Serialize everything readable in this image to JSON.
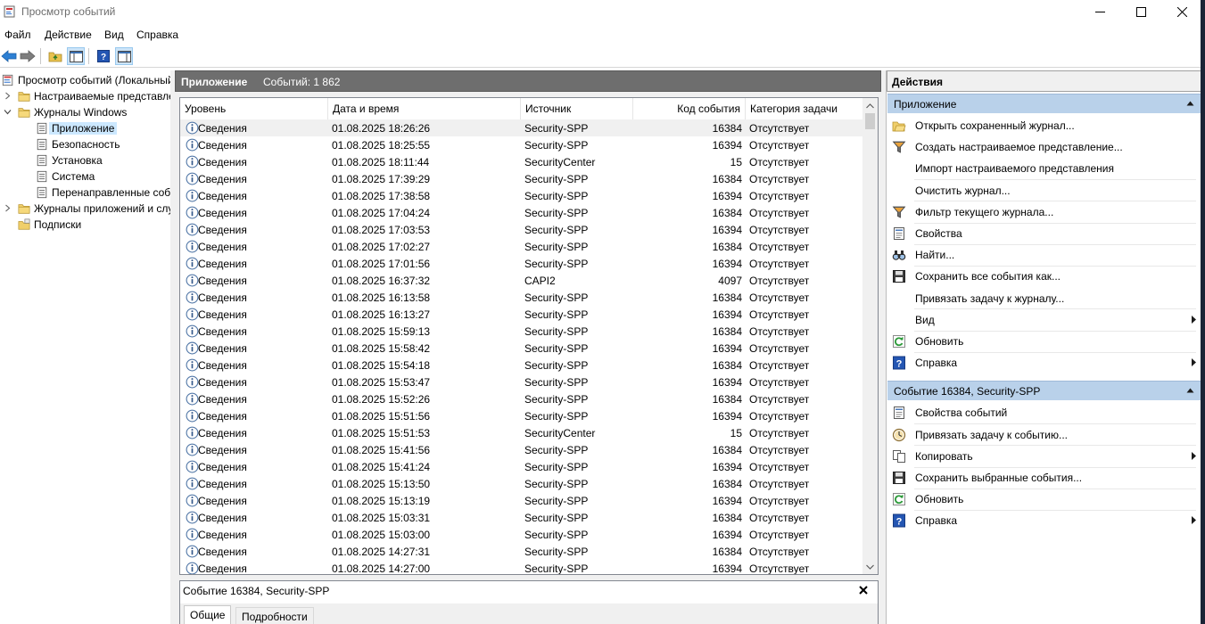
{
  "window": {
    "title": "Просмотр событий"
  },
  "menu": [
    "Файл",
    "Действие",
    "Вид",
    "Справка"
  ],
  "tree": [
    {
      "label": "Просмотр событий (Локальный)",
      "icon": "event-viewer-icon",
      "level": 0,
      "expander": "none"
    },
    {
      "label": "Настраиваемые представления",
      "icon": "folder-icon",
      "level": 1,
      "expander": "collapsed"
    },
    {
      "label": "Журналы Windows",
      "icon": "folder-icon",
      "level": 1,
      "expander": "expanded"
    },
    {
      "label": "Приложение",
      "icon": "log-icon",
      "level": 2,
      "expander": "none",
      "selected": true
    },
    {
      "label": "Безопасность",
      "icon": "log-icon",
      "level": 2,
      "expander": "none"
    },
    {
      "label": "Установка",
      "icon": "log-icon",
      "level": 2,
      "expander": "none"
    },
    {
      "label": "Система",
      "icon": "log-icon",
      "level": 2,
      "expander": "none"
    },
    {
      "label": "Перенаправленные события",
      "icon": "log-icon",
      "level": 2,
      "expander": "none"
    },
    {
      "label": "Журналы приложений и служб",
      "icon": "folder-icon",
      "level": 1,
      "expander": "collapsed"
    },
    {
      "label": "Подписки",
      "icon": "subscriptions-icon",
      "level": 1,
      "expander": "none"
    }
  ],
  "center": {
    "title": "Приложение",
    "count": "Событий: 1 862",
    "columns": [
      "Уровень",
      "Дата и время",
      "Источник",
      "Код события",
      "Категория задачи"
    ],
    "rows": [
      [
        "Сведения",
        "01.08.2025 18:26:26",
        "Security-SPP",
        "16384",
        "Отсутствует"
      ],
      [
        "Сведения",
        "01.08.2025 18:25:55",
        "Security-SPP",
        "16394",
        "Отсутствует"
      ],
      [
        "Сведения",
        "01.08.2025 18:11:44",
        "SecurityCenter",
        "15",
        "Отсутствует"
      ],
      [
        "Сведения",
        "01.08.2025 17:39:29",
        "Security-SPP",
        "16384",
        "Отсутствует"
      ],
      [
        "Сведения",
        "01.08.2025 17:38:58",
        "Security-SPP",
        "16394",
        "Отсутствует"
      ],
      [
        "Сведения",
        "01.08.2025 17:04:24",
        "Security-SPP",
        "16384",
        "Отсутствует"
      ],
      [
        "Сведения",
        "01.08.2025 17:03:53",
        "Security-SPP",
        "16394",
        "Отсутствует"
      ],
      [
        "Сведения",
        "01.08.2025 17:02:27",
        "Security-SPP",
        "16384",
        "Отсутствует"
      ],
      [
        "Сведения",
        "01.08.2025 17:01:56",
        "Security-SPP",
        "16394",
        "Отсутствует"
      ],
      [
        "Сведения",
        "01.08.2025 16:37:32",
        "CAPI2",
        "4097",
        "Отсутствует"
      ],
      [
        "Сведения",
        "01.08.2025 16:13:58",
        "Security-SPP",
        "16384",
        "Отсутствует"
      ],
      [
        "Сведения",
        "01.08.2025 16:13:27",
        "Security-SPP",
        "16394",
        "Отсутствует"
      ],
      [
        "Сведения",
        "01.08.2025 15:59:13",
        "Security-SPP",
        "16384",
        "Отсутствует"
      ],
      [
        "Сведения",
        "01.08.2025 15:58:42",
        "Security-SPP",
        "16394",
        "Отсутствует"
      ],
      [
        "Сведения",
        "01.08.2025 15:54:18",
        "Security-SPP",
        "16384",
        "Отсутствует"
      ],
      [
        "Сведения",
        "01.08.2025 15:53:47",
        "Security-SPP",
        "16394",
        "Отсутствует"
      ],
      [
        "Сведения",
        "01.08.2025 15:52:26",
        "Security-SPP",
        "16384",
        "Отсутствует"
      ],
      [
        "Сведения",
        "01.08.2025 15:51:56",
        "Security-SPP",
        "16394",
        "Отсутствует"
      ],
      [
        "Сведения",
        "01.08.2025 15:51:53",
        "SecurityCenter",
        "15",
        "Отсутствует"
      ],
      [
        "Сведения",
        "01.08.2025 15:41:56",
        "Security-SPP",
        "16384",
        "Отсутствует"
      ],
      [
        "Сведения",
        "01.08.2025 15:41:24",
        "Security-SPP",
        "16394",
        "Отсутствует"
      ],
      [
        "Сведения",
        "01.08.2025 15:13:50",
        "Security-SPP",
        "16384",
        "Отсутствует"
      ],
      [
        "Сведения",
        "01.08.2025 15:13:19",
        "Security-SPP",
        "16394",
        "Отсутствует"
      ],
      [
        "Сведения",
        "01.08.2025 15:03:31",
        "Security-SPP",
        "16384",
        "Отсутствует"
      ],
      [
        "Сведения",
        "01.08.2025 15:03:00",
        "Security-SPP",
        "16394",
        "Отсутствует"
      ],
      [
        "Сведения",
        "01.08.2025 14:27:31",
        "Security-SPP",
        "16384",
        "Отсутствует"
      ],
      [
        "Сведения",
        "01.08.2025 14:27:00",
        "Security-SPP",
        "16394",
        "Отсутствует"
      ]
    ],
    "row_icon": "info-icon"
  },
  "detail": {
    "title": "Событие 16384, Security-SPP",
    "tabs": [
      "Общие",
      "Подробности"
    ]
  },
  "actions": {
    "title": "Действия",
    "sections": [
      {
        "label": "Приложение",
        "items": [
          {
            "label": "Открыть сохраненный журнал...",
            "icon": "open-log-icon"
          },
          {
            "label": "Создать настраиваемое представление...",
            "icon": "filter-icon"
          },
          {
            "label": "Импорт настраиваемого представления",
            "icon": ""
          },
          {
            "label": "Очистить журнал...",
            "icon": "",
            "sep_before": true
          },
          {
            "label": "Фильтр текущего журнала...",
            "icon": "filter-icon",
            "sep_before": true
          },
          {
            "label": "Свойства",
            "icon": "properties-icon",
            "sep_before": true
          },
          {
            "label": "Найти...",
            "icon": "find-icon",
            "sep_before": true
          },
          {
            "label": "Сохранить все события как...",
            "icon": "save-icon",
            "sep_before": true
          },
          {
            "label": "Привязать задачу к журналу...",
            "icon": ""
          },
          {
            "label": "Вид",
            "icon": "",
            "submenu": true,
            "sep_before": true
          },
          {
            "label": "Обновить",
            "icon": "refresh-icon",
            "sep_before": true
          },
          {
            "label": "Справка",
            "icon": "help-icon",
            "submenu": true,
            "sep_before": true
          }
        ]
      },
      {
        "label": "Событие 16384, Security-SPP",
        "items": [
          {
            "label": "Свойства событий",
            "icon": "event-properties-icon"
          },
          {
            "label": "Привязать задачу к событию...",
            "icon": "task-icon",
            "sep_before": true
          },
          {
            "label": "Копировать",
            "icon": "copy-icon",
            "submenu": true,
            "sep_before": true
          },
          {
            "label": "Сохранить выбранные события...",
            "icon": "save-icon",
            "sep_before": true
          },
          {
            "label": "Обновить",
            "icon": "refresh-icon",
            "sep_before": true
          },
          {
            "label": "Справка",
            "icon": "help-icon",
            "submenu": true,
            "sep_before": true
          }
        ]
      }
    ]
  }
}
